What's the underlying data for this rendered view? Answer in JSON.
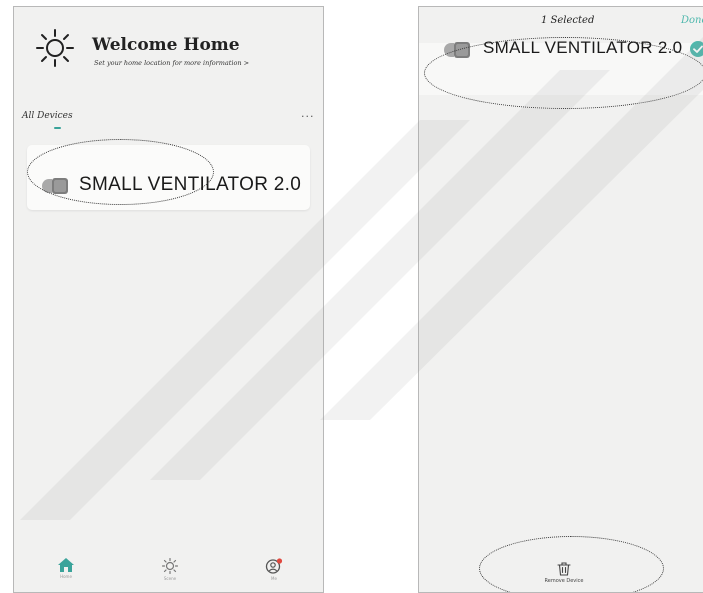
{
  "left_screen": {
    "header": {
      "title": "Welcome Home",
      "subtitle": "Set your home location for more information >"
    },
    "section": {
      "label": "All Devices",
      "more": "..."
    },
    "device": {
      "name": "SMALL VENTILATOR 2.0",
      "icon": "ventilator-device-icon"
    },
    "tabbar": {
      "tabs": [
        {
          "label": "Home",
          "icon": "home-icon",
          "active": true
        },
        {
          "label": "Scene",
          "icon": "scene-icon",
          "active": false
        },
        {
          "label": "Me",
          "icon": "profile-icon",
          "active": false
        }
      ]
    }
  },
  "right_screen": {
    "header": {
      "title": "1 Selected",
      "done": "Done"
    },
    "device": {
      "name": "SMALL VENTILATOR 2.0",
      "icon": "ventilator-device-icon",
      "selected": true
    },
    "remove": {
      "label": "Remove Device",
      "icon": "trash-icon"
    }
  },
  "colors": {
    "accent": "#4fb8ad",
    "background": "#f1f1f0",
    "card": "#fbfbfa",
    "notification": "#e0483e"
  }
}
